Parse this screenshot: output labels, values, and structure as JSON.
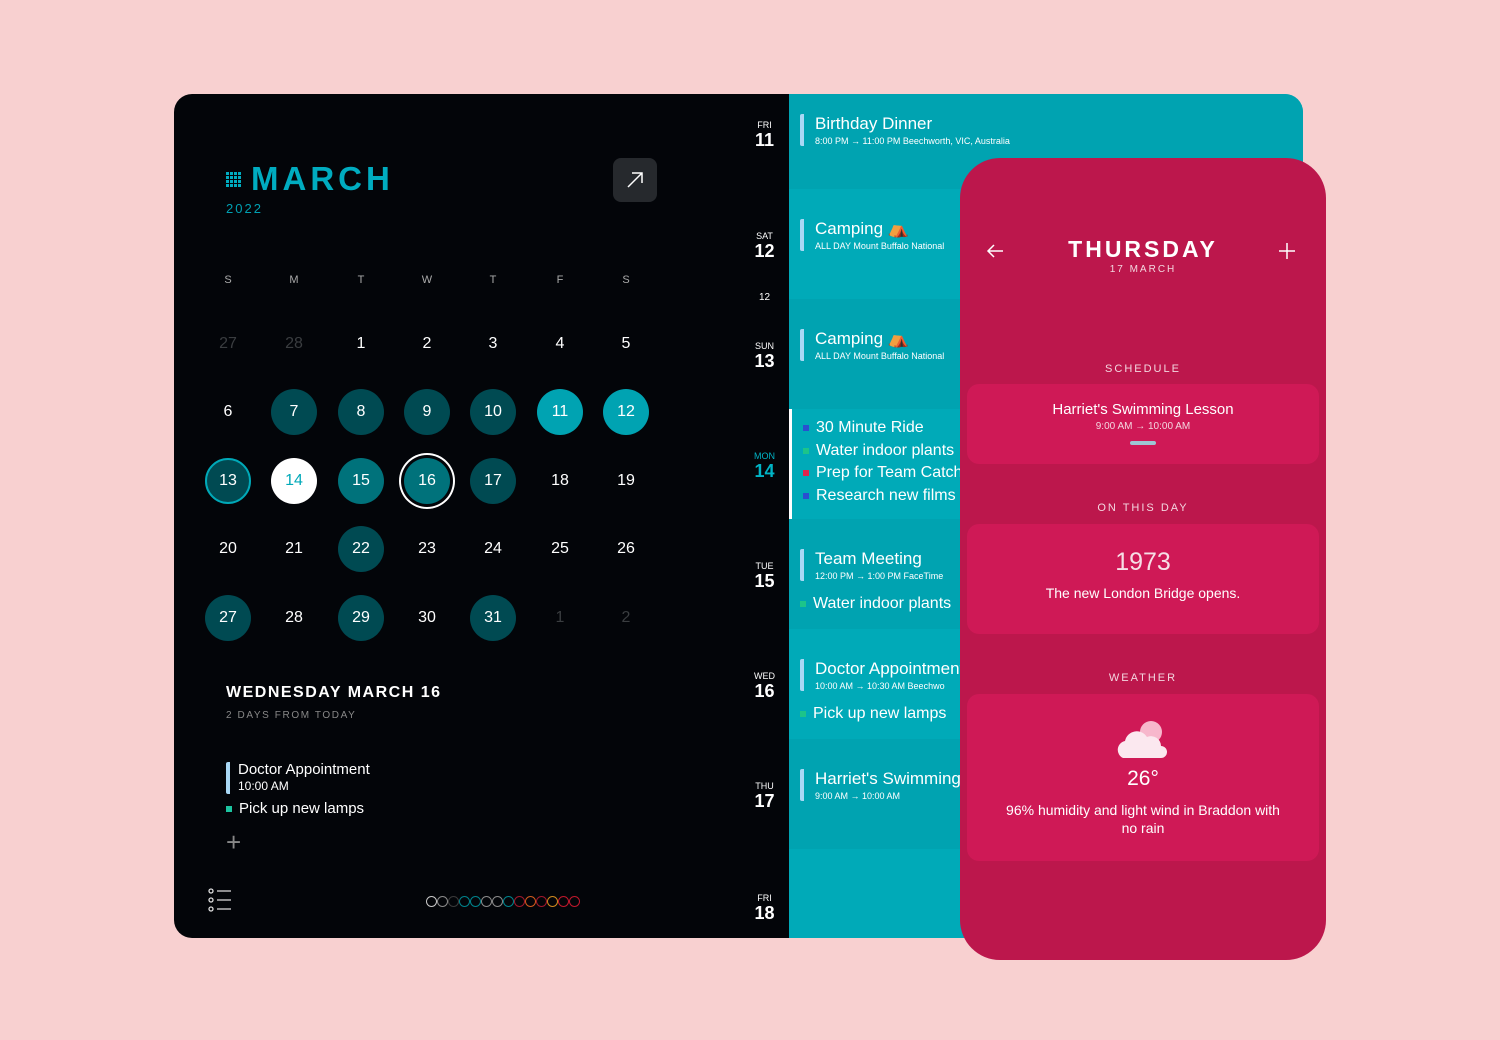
{
  "calendar": {
    "month": "MARCH",
    "year": "2022",
    "weekdays": [
      "S",
      "M",
      "T",
      "W",
      "T",
      "F",
      "S"
    ],
    "cells": [
      {
        "d": "27",
        "s": "out"
      },
      {
        "d": "28",
        "s": "out"
      },
      {
        "d": "1",
        "s": "plain"
      },
      {
        "d": "2",
        "s": "plain"
      },
      {
        "d": "3",
        "s": "plain"
      },
      {
        "d": "4",
        "s": "plain"
      },
      {
        "d": "5",
        "s": "plain"
      },
      {
        "d": "6",
        "s": "plain"
      },
      {
        "d": "7",
        "s": "dark"
      },
      {
        "d": "8",
        "s": "dark"
      },
      {
        "d": "9",
        "s": "dark"
      },
      {
        "d": "10",
        "s": "dark"
      },
      {
        "d": "11",
        "s": "bright"
      },
      {
        "d": "12",
        "s": "bright"
      },
      {
        "d": "13",
        "s": "ring"
      },
      {
        "d": "14",
        "s": "today"
      },
      {
        "d": "15",
        "s": "mid"
      },
      {
        "d": "16",
        "s": "selected"
      },
      {
        "d": "17",
        "s": "dark"
      },
      {
        "d": "18",
        "s": "plain"
      },
      {
        "d": "19",
        "s": "plain"
      },
      {
        "d": "20",
        "s": "plain"
      },
      {
        "d": "21",
        "s": "plain"
      },
      {
        "d": "22",
        "s": "dark"
      },
      {
        "d": "23",
        "s": "plain"
      },
      {
        "d": "24",
        "s": "plain"
      },
      {
        "d": "25",
        "s": "plain"
      },
      {
        "d": "26",
        "s": "plain"
      },
      {
        "d": "27",
        "s": "dark"
      },
      {
        "d": "28",
        "s": "plain"
      },
      {
        "d": "29",
        "s": "dark"
      },
      {
        "d": "30",
        "s": "plain"
      },
      {
        "d": "31",
        "s": "dark"
      },
      {
        "d": "1",
        "s": "out"
      },
      {
        "d": "2",
        "s": "out"
      }
    ]
  },
  "selected": {
    "heading": "WEDNESDAY MARCH 16",
    "sub": "2 DAYS FROM TODAY",
    "event_title": "Doctor Appointment",
    "event_time": "10:00 AM",
    "task": "Pick up new lamps"
  },
  "theme_dots": [
    "#c8c8c8",
    "#8a8a8a",
    "#3a3a3a",
    "#00838c",
    "#00838c",
    "#8a8a8a",
    "#8a8a8a",
    "#00838c",
    "#a0182c",
    "#d05a1e",
    "#a0182c",
    "#d08a1e",
    "#c0182c",
    "#c0182c"
  ],
  "agenda": {
    "hour_marker": "12",
    "days": [
      {
        "dow": "FRI",
        "day": "11",
        "items": [
          {
            "type": "event",
            "title": "Birthday Dinner",
            "meta": "8:00 PM → 11:00 PM   Beechworth, VIC, Australia"
          }
        ]
      },
      {
        "dow": "SAT",
        "day": "12",
        "items": [
          {
            "type": "event",
            "title": "Camping ⛺",
            "meta": "ALL DAY   Mount Buffalo National"
          }
        ]
      },
      {
        "dow": "SUN",
        "day": "13",
        "items": [
          {
            "type": "event",
            "title": "Camping ⛺",
            "meta": "ALL DAY   Mount Buffalo National"
          }
        ]
      },
      {
        "dow": "MON",
        "day": "14",
        "today": true,
        "items": [
          {
            "type": "task",
            "title": "30 Minute Ride",
            "color": "#2a4fd0"
          },
          {
            "type": "task",
            "title": "Water indoor plants",
            "color": "#1cc48a"
          },
          {
            "type": "task",
            "title": "Prep for Team Catch",
            "color": "#e0244c"
          },
          {
            "type": "task",
            "title": "Research new films",
            "color": "#2a4fd0"
          }
        ]
      },
      {
        "dow": "TUE",
        "day": "15",
        "items": [
          {
            "type": "event",
            "title": "Team Meeting",
            "meta": "12:00 PM → 1:00 PM   FaceTime"
          },
          {
            "type": "task",
            "title": "Water indoor plants",
            "color": "#1cc48a"
          }
        ]
      },
      {
        "dow": "WED",
        "day": "16",
        "items": [
          {
            "type": "event",
            "title": "Doctor Appointment",
            "meta": "10:00 AM → 10:30 AM   Beechwo"
          },
          {
            "type": "task",
            "title": "Pick up new lamps",
            "color": "#1cc48a"
          }
        ]
      },
      {
        "dow": "THU",
        "day": "17",
        "items": [
          {
            "type": "event",
            "title": "Harriet's Swimming",
            "meta": "9:00 AM → 10:00 AM"
          }
        ]
      },
      {
        "dow": "FRI",
        "day": "18",
        "items": []
      }
    ]
  },
  "day_view": {
    "title": "THURSDAY",
    "date": "17 MARCH",
    "schedule_label": "SCHEDULE",
    "schedule_title": "Harriet's Swimming Lesson",
    "schedule_time": "9:00 AM → 10:00 AM",
    "on_this_day_label": "ON THIS DAY",
    "year": "1973",
    "fact": "The new London Bridge opens.",
    "weather_label": "WEATHER",
    "icon": "partly-cloudy-icon",
    "temp": "26°",
    "weather_desc": "96% humidity and light wind in Braddon with no rain"
  }
}
